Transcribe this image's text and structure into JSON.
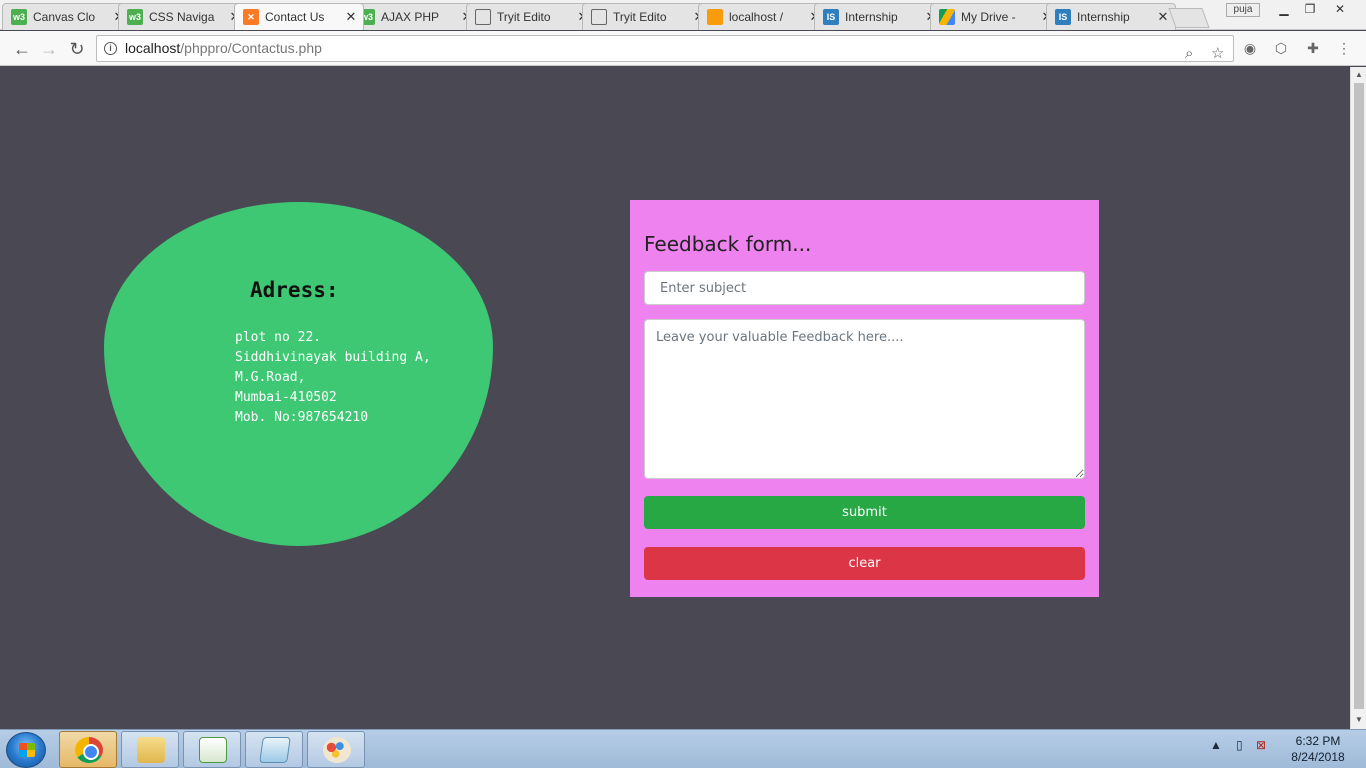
{
  "browser": {
    "tabs": [
      {
        "label": "Canvas Clo",
        "icon": "w3schools-icon",
        "active": false
      },
      {
        "label": "CSS Naviga",
        "icon": "w3schools-icon",
        "active": false
      },
      {
        "label": "Contact Us",
        "icon": "xampp-icon",
        "active": true
      },
      {
        "label": "AJAX PHP",
        "icon": "w3schools-icon",
        "active": false
      },
      {
        "label": "Tryit Edito",
        "icon": "document-icon",
        "active": false
      },
      {
        "label": "Tryit Edito",
        "icon": "document-icon",
        "active": false
      },
      {
        "label": "localhost /",
        "icon": "phpmyadmin-icon",
        "active": false
      },
      {
        "label": "Internship",
        "icon": "internshala-icon",
        "active": false
      },
      {
        "label": "My Drive -",
        "icon": "google-drive-icon",
        "active": false
      },
      {
        "label": "Internship",
        "icon": "internshala-icon",
        "active": false
      }
    ],
    "user_badge": "puja",
    "url_host": "localhost",
    "url_path": "/phppro/Contactus.php"
  },
  "address": {
    "title": "Adress:",
    "lines": [
      "plot no 22.",
      "Siddhivinayak building A,",
      "M.G.Road,",
      "Mumbai-410502",
      "Mob. No:987654210"
    ]
  },
  "feedback": {
    "title": "Feedback form...",
    "subject_placeholder": "Enter subject",
    "message_placeholder": "Leave your valuable Feedback here....",
    "submit_label": "submit",
    "clear_label": "clear"
  },
  "taskbar": {
    "time": "6:32 PM",
    "date": "8/24/2018"
  },
  "colors": {
    "page_background": "#4a4953",
    "address_circle": "#3ec874",
    "feedback_panel": "#ee82ee",
    "submit_button": "#28a745",
    "clear_button": "#dc3545"
  }
}
